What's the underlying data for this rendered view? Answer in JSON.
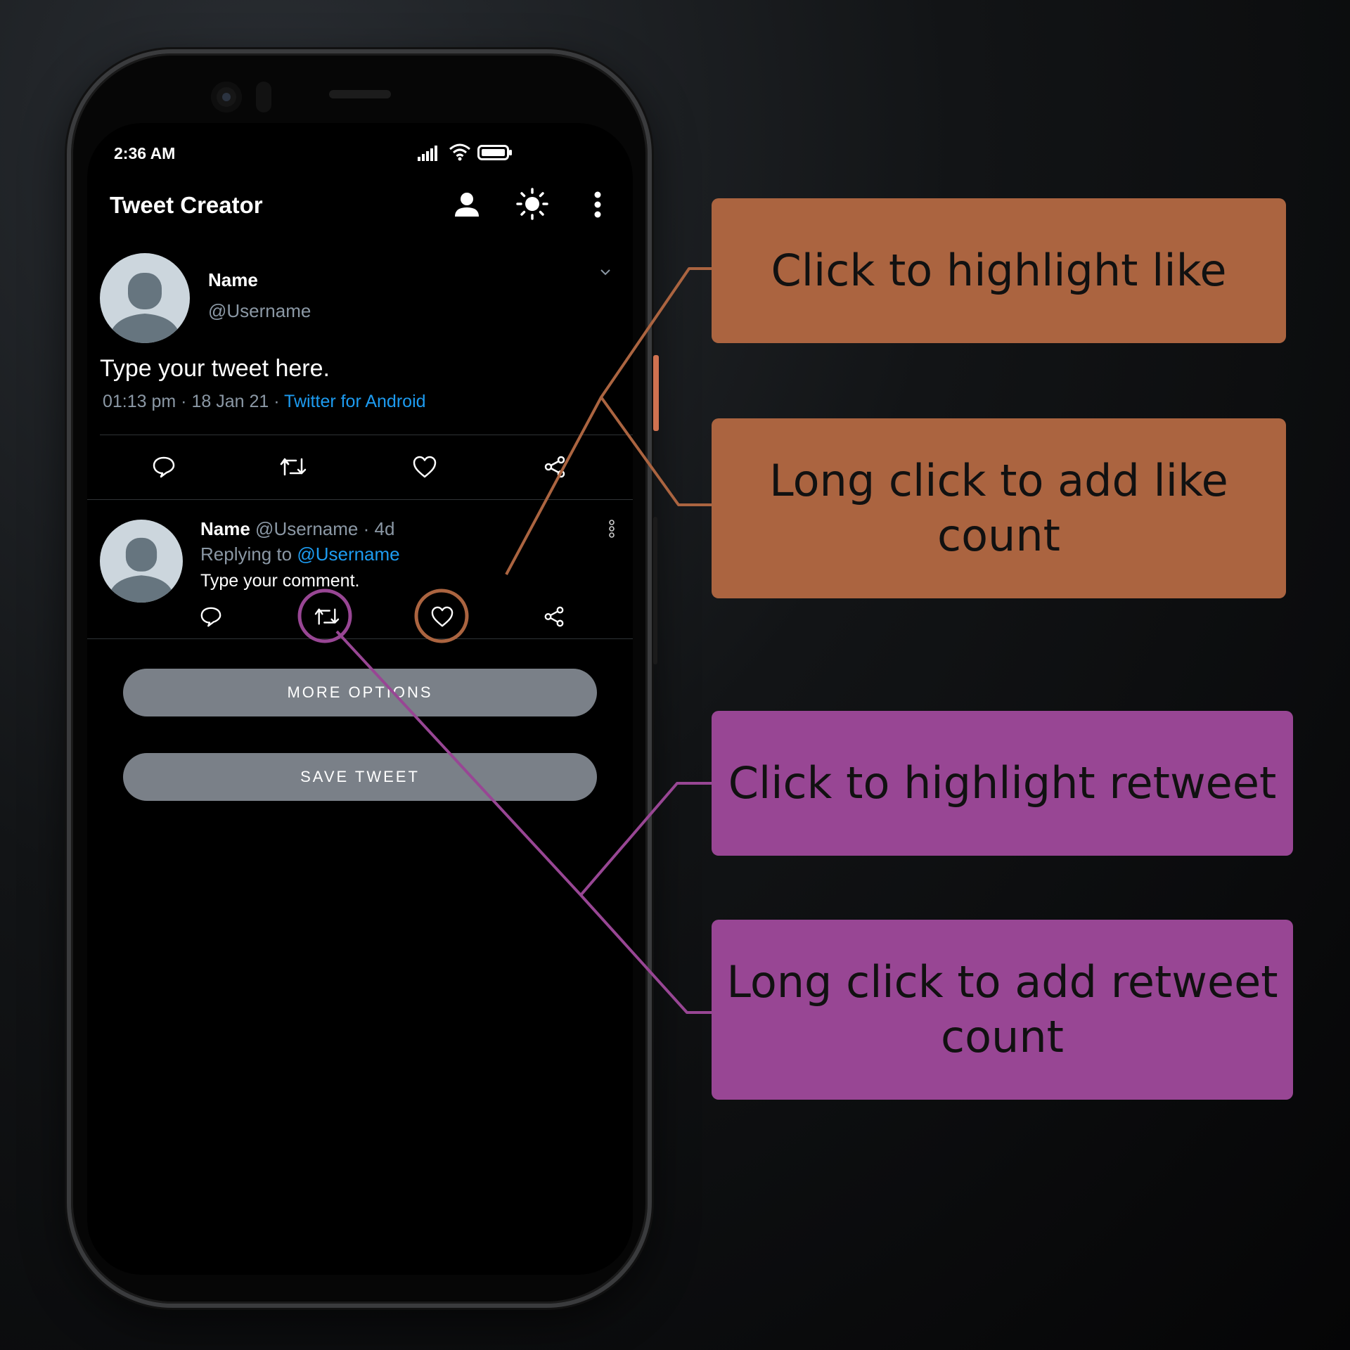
{
  "status_bar": {
    "time": "2:36 AM"
  },
  "app_bar": {
    "title": "Tweet Creator"
  },
  "tweet": {
    "name": "Name",
    "handle": "@Username",
    "text": "Type your tweet here.",
    "meta_time": "01:13 pm · 18 Jan 21 · ",
    "meta_source": "Twitter for Android"
  },
  "reply": {
    "name": "Name",
    "handle_age": " @Username · 4d",
    "replying_prefix": "Replying to ",
    "replying_handle": "@Username",
    "text": "Type your comment."
  },
  "buttons": {
    "more_options": "MORE OPTIONS",
    "save_tweet": "SAVE TWEET"
  },
  "callouts": {
    "highlight_like": "Click to highlight like",
    "add_like": "Long click to add like count",
    "highlight_retweet": "Click to highlight retweet",
    "add_retweet": "Long click to add retweet count"
  },
  "icons": [
    "profile-icon",
    "brightness-icon",
    "overflow-menu-icon",
    "chevron-down-icon",
    "reply-icon",
    "retweet-icon",
    "like-icon",
    "share-icon",
    "more-vertical-icon"
  ],
  "colors": {
    "link": "#1d9bf0",
    "button": "#7a8088",
    "callout_like": "#ab6440",
    "callout_retweet": "#984694"
  }
}
